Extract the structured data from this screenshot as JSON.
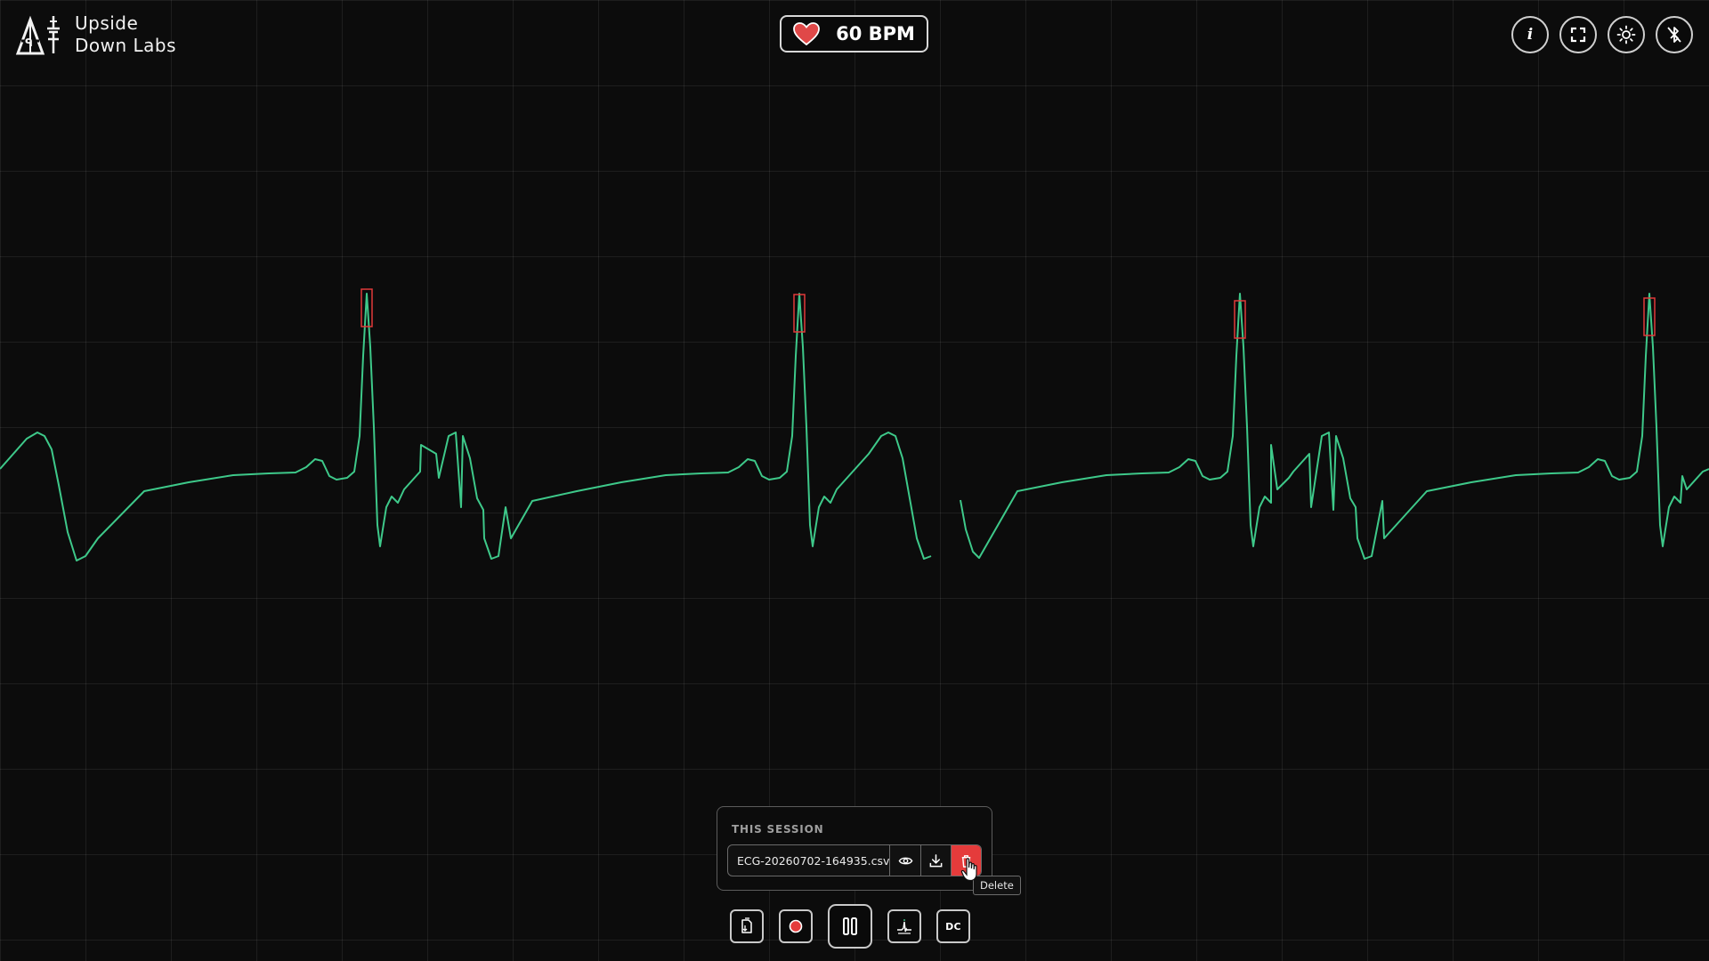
{
  "brand": {
    "name_line1": "Upside",
    "name_line2": "Down Labs"
  },
  "heart_rate": {
    "label": "60 BPM",
    "value": 60,
    "icon": "heart-icon",
    "icon_color": "#e04848"
  },
  "top_actions": [
    {
      "icon": "info-icon",
      "glyph": "i"
    },
    {
      "icon": "fullscreen-icon"
    },
    {
      "icon": "brightness-icon"
    },
    {
      "icon": "bluetooth-off-icon"
    }
  ],
  "session": {
    "title": "THIS SESSION",
    "file_name": "ECG-20260702-164935.csv",
    "actions": [
      "view-icon",
      "download-icon",
      "delete-icon"
    ],
    "tooltip": "Delete"
  },
  "toolbar": {
    "buttons": [
      "files-icon",
      "record-icon",
      "pause-icon",
      "filter-icon",
      "dc"
    ],
    "dc_label": "DC"
  },
  "colors": {
    "background": "#0c0c0c",
    "grid": "#2a2a2a",
    "trace": "#3ec98a",
    "peak_marker": "#e03a3a",
    "record": "#e53b3b",
    "delete_active": "#e53b3b"
  },
  "chart_data": {
    "type": "line",
    "grid": true,
    "series": [
      {
        "kind": "ecg-waveform",
        "beats_visible": 4,
        "rate_bpm": 60
      }
    ]
  }
}
